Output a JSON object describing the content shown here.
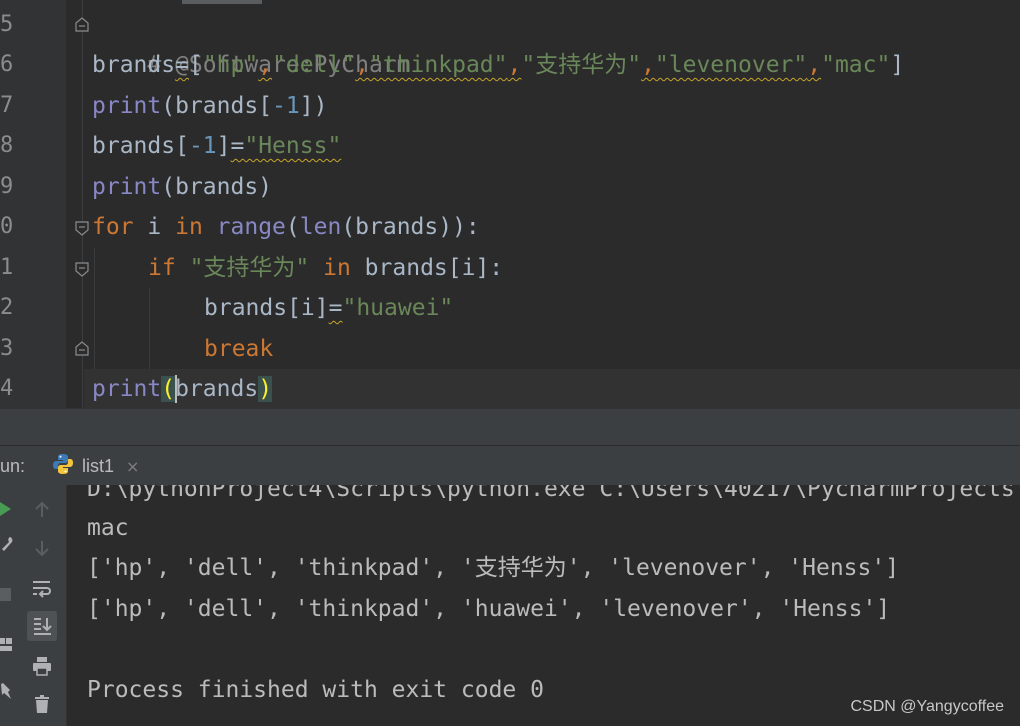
{
  "editor": {
    "line_numbers": [
      "5",
      "6",
      "7",
      "8",
      "9",
      "0",
      "1",
      "2",
      "3",
      "4"
    ],
    "code": {
      "l5": {
        "comment": "# @Software:PyCharm"
      },
      "l6": {
        "var": "brands",
        "eq": "=",
        "open": "[",
        "items": [
          "\"hp\"",
          "\"dell\"",
          "\"thinkpad\"",
          "\"支持华为\"",
          "\"levenover\"",
          "\"mac\""
        ],
        "comma": ",",
        "close": "]"
      },
      "l7": {
        "fn": "print",
        "open": "(",
        "arg": "brands[",
        "idx": "-1",
        "close": "])"
      },
      "l8": {
        "var": "brands[",
        "idx": "-1",
        "close": "]",
        "eq": "=",
        "str": "\"Henss\""
      },
      "l9": {
        "fn": "print",
        "args": "(brands)"
      },
      "l10": {
        "kw_for": "for",
        "var": " i ",
        "kw_in": "in",
        "sp": " ",
        "fn_range": "range",
        "p1": "(",
        "fn_len": "len",
        "rest": "(brands)):"
      },
      "l11": {
        "kw_if": "if",
        "sp": " ",
        "str": "\"支持华为\"",
        "sp2": " ",
        "kw_in": "in",
        "rest": " brands[i]:"
      },
      "l12": {
        "var": "brands[i]",
        "eq": "=",
        "str": "\"huawei\""
      },
      "l13": {
        "kw": "break"
      },
      "l14": {
        "fn": "print",
        "open": "(",
        "arg": "brands",
        "close": ")"
      }
    }
  },
  "run": {
    "label": "un:",
    "tab_title": "list1",
    "tab_close": "×",
    "output": [
      "D:\\pythonProject4\\Scripts\\python.exe C:\\Users\\40217\\PycharmProjects",
      "mac",
      "['hp', 'dell', 'thinkpad', '支持华为', 'levenover', 'Henss']",
      "['hp', 'dell', 'thinkpad', 'huawei', 'levenover', 'Henss']",
      "",
      "Process finished with exit code 0"
    ]
  },
  "watermark": "CSDN @Yangycoffee",
  "colors": {
    "editor_bg": "#2b2b2b",
    "keyword": "#cc7832",
    "builtin": "#8888c6",
    "string": "#6a8759",
    "number": "#6897bb",
    "comment": "#808080",
    "run_green": "#499c54"
  }
}
